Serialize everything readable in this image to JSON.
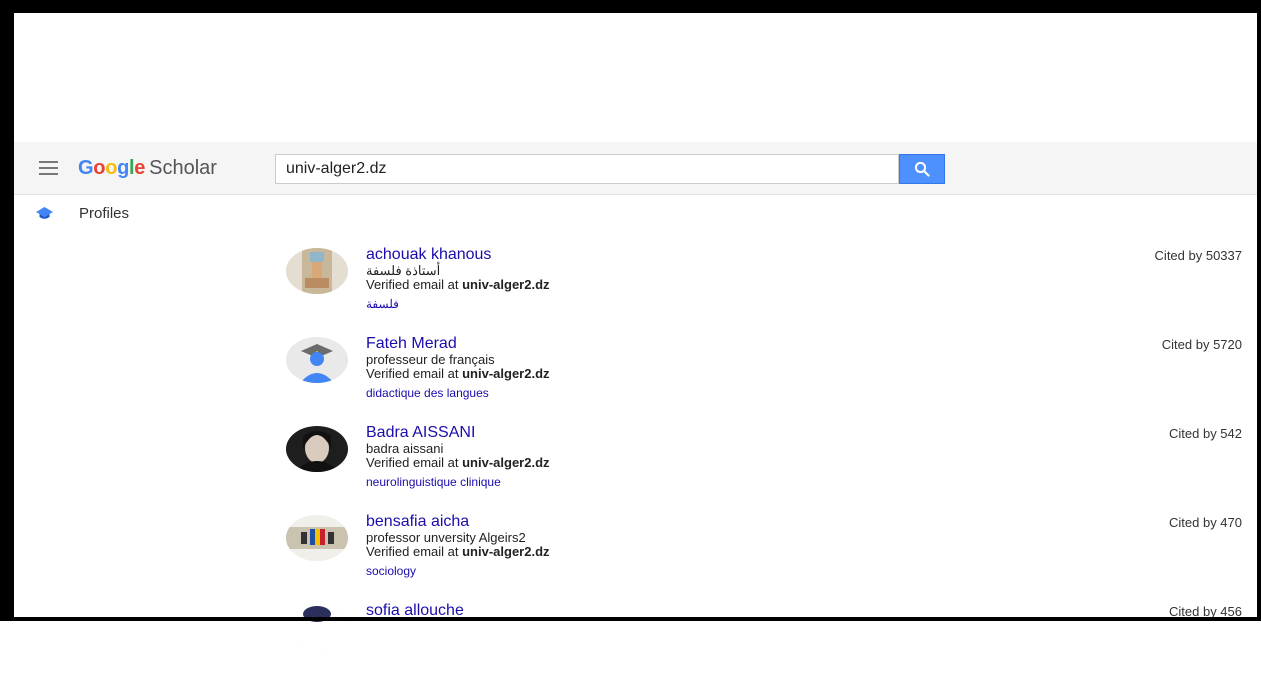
{
  "app": {
    "logo_letters": [
      "G",
      "o",
      "o",
      "g",
      "l",
      "e"
    ],
    "product": "Scholar"
  },
  "search": {
    "query": "univ-alger2.dz"
  },
  "section": {
    "label": "Profiles"
  },
  "profiles": [
    {
      "name": "achouak khanous",
      "affiliation": "أستاذة فلسفة",
      "email_prefix": "Verified email at ",
      "email_domain": "univ-alger2.dz",
      "topic": "فلسفة",
      "cited": "Cited by 50337",
      "avatar": "photo"
    },
    {
      "name": "Fateh Merad",
      "affiliation": "professeur de français",
      "email_prefix": "Verified email at ",
      "email_domain": "univ-alger2.dz",
      "topic": "didactique des langues",
      "cited": "Cited by 5720",
      "avatar": "default-graduate-icon"
    },
    {
      "name": "Badra AISSANI",
      "affiliation": "badra aissani",
      "email_prefix": "Verified email at ",
      "email_domain": "univ-alger2.dz",
      "topic": "neurolinguistique clinique",
      "cited": "Cited by 542",
      "avatar": "photo"
    },
    {
      "name": "bensafia aicha",
      "affiliation": "professor unversity Algeirs2",
      "email_prefix": "Verified email at ",
      "email_domain": "univ-alger2.dz",
      "topic": "sociology",
      "cited": "Cited by 470",
      "avatar": "photo"
    },
    {
      "name": "sofia allouche",
      "affiliation": "",
      "email_prefix": "",
      "email_domain": "",
      "topic": "",
      "cited": "Cited by 456",
      "avatar": "photo"
    }
  ],
  "colors": {
    "link": "#1a0dab",
    "search_button": "#4d90fe",
    "header_bg": "#f5f5f5"
  }
}
